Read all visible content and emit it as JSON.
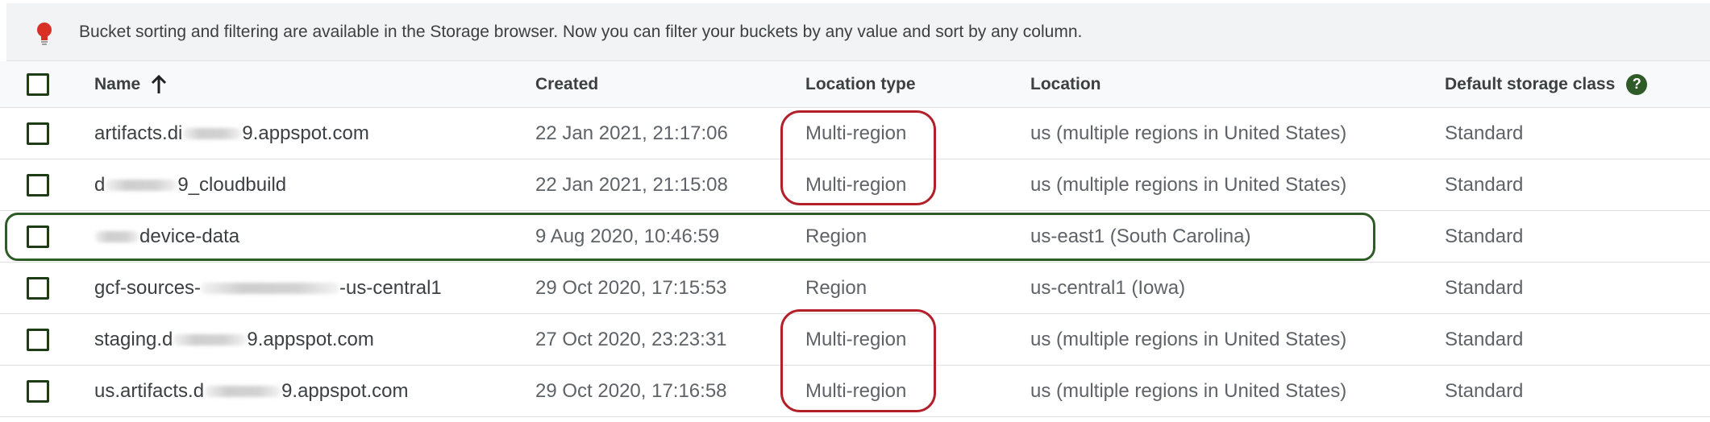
{
  "banner": {
    "icon": "lightbulb-icon",
    "text": "Bucket sorting and filtering are available in the Storage browser. Now you can filter your buckets by any value and sort by any column."
  },
  "columns": {
    "name": "Name",
    "created": "Created",
    "location_type": "Location type",
    "location": "Location",
    "default_storage_class": "Default storage class",
    "sort_icon": "arrow-up-icon",
    "help_icon": "help-icon",
    "help_glyph": "?"
  },
  "rows": [
    {
      "name_prefix": "artifacts.di",
      "name_suffix": "9.appspot.com",
      "created": "22 Jan 2021, 21:17:06",
      "location_type": "Multi-region",
      "location": "us (multiple regions in United States)",
      "storage_class": "Standard"
    },
    {
      "name_prefix": "d",
      "name_suffix": "9_cloudbuild",
      "created": "22 Jan 2021, 21:15:08",
      "location_type": "Multi-region",
      "location": "us (multiple regions in United States)",
      "storage_class": "Standard"
    },
    {
      "name_prefix": "",
      "name_suffix": "device-data",
      "created": "9 Aug 2020, 10:46:59",
      "location_type": "Region",
      "location": "us-east1 (South Carolina)",
      "storage_class": "Standard"
    },
    {
      "name_prefix": "gcf-sources-",
      "name_suffix": "-us-central1",
      "created": "29 Oct 2020, 17:15:53",
      "location_type": "Region",
      "location": "us-central1 (Iowa)",
      "storage_class": "Standard"
    },
    {
      "name_prefix": "staging.d",
      "name_suffix": "9.appspot.com",
      "created": "27 Oct 2020, 23:23:31",
      "location_type": "Multi-region",
      "location": "us (multiple regions in United States)",
      "storage_class": "Standard"
    },
    {
      "name_prefix": "us.artifacts.d",
      "name_suffix": "9.appspot.com",
      "created": "29 Oct 2020, 17:16:58",
      "location_type": "Multi-region",
      "location": "us (multiple regions in United States)",
      "storage_class": "Standard"
    }
  ],
  "colors": {
    "annotation_red": "#b3202a",
    "annotation_green": "#2e5b27",
    "checkbox_border": "#1e3d14",
    "bulb_red": "#d93025"
  }
}
